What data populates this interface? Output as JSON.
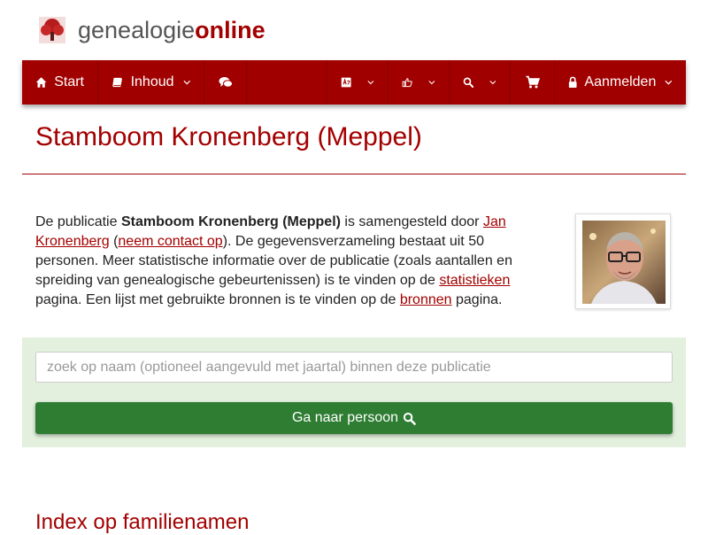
{
  "brand": {
    "part1": "genealogie",
    "part2": "online"
  },
  "nav": {
    "start": "Start",
    "inhoud": "Inhoud",
    "login": "Aanmelden",
    "icons": [
      "home-icon",
      "book-icon",
      "comments-icon",
      "language-icon",
      "thumbs-icon",
      "search-icon",
      "cart-icon",
      "lock-icon"
    ]
  },
  "page": {
    "title": "Stamboom Kronenberg (Meppel)"
  },
  "intro": {
    "t1": "De publicatie ",
    "pub": "Stamboom Kronenberg (Meppel)",
    "t2": " is samengesteld door ",
    "author": "Jan Kronenberg",
    "t3": " (",
    "contact": "neem contact op",
    "t4": "). De gegevensverzameling bestaat uit 50 personen. Meer statistische informatie over de publicatie (zoals aantallen en spreiding van genealogische gebeurtenissen) is te vinden op de ",
    "stats": "statistieken",
    "t5": " pagina. Een lijst met gebruikte bronnen is te vinden op de ",
    "sources": "bronnen",
    "t6": " pagina."
  },
  "search": {
    "placeholder": "zoek op naam (optioneel aangevuld met jaartal) binnen deze publicatie",
    "button": "Ga naar persoon"
  },
  "sections": {
    "index_title": "Index op familienamen"
  },
  "colors": {
    "brand_red": "#a10000",
    "panel_green": "#e2f0dd",
    "button_green": "#2e7d32"
  }
}
